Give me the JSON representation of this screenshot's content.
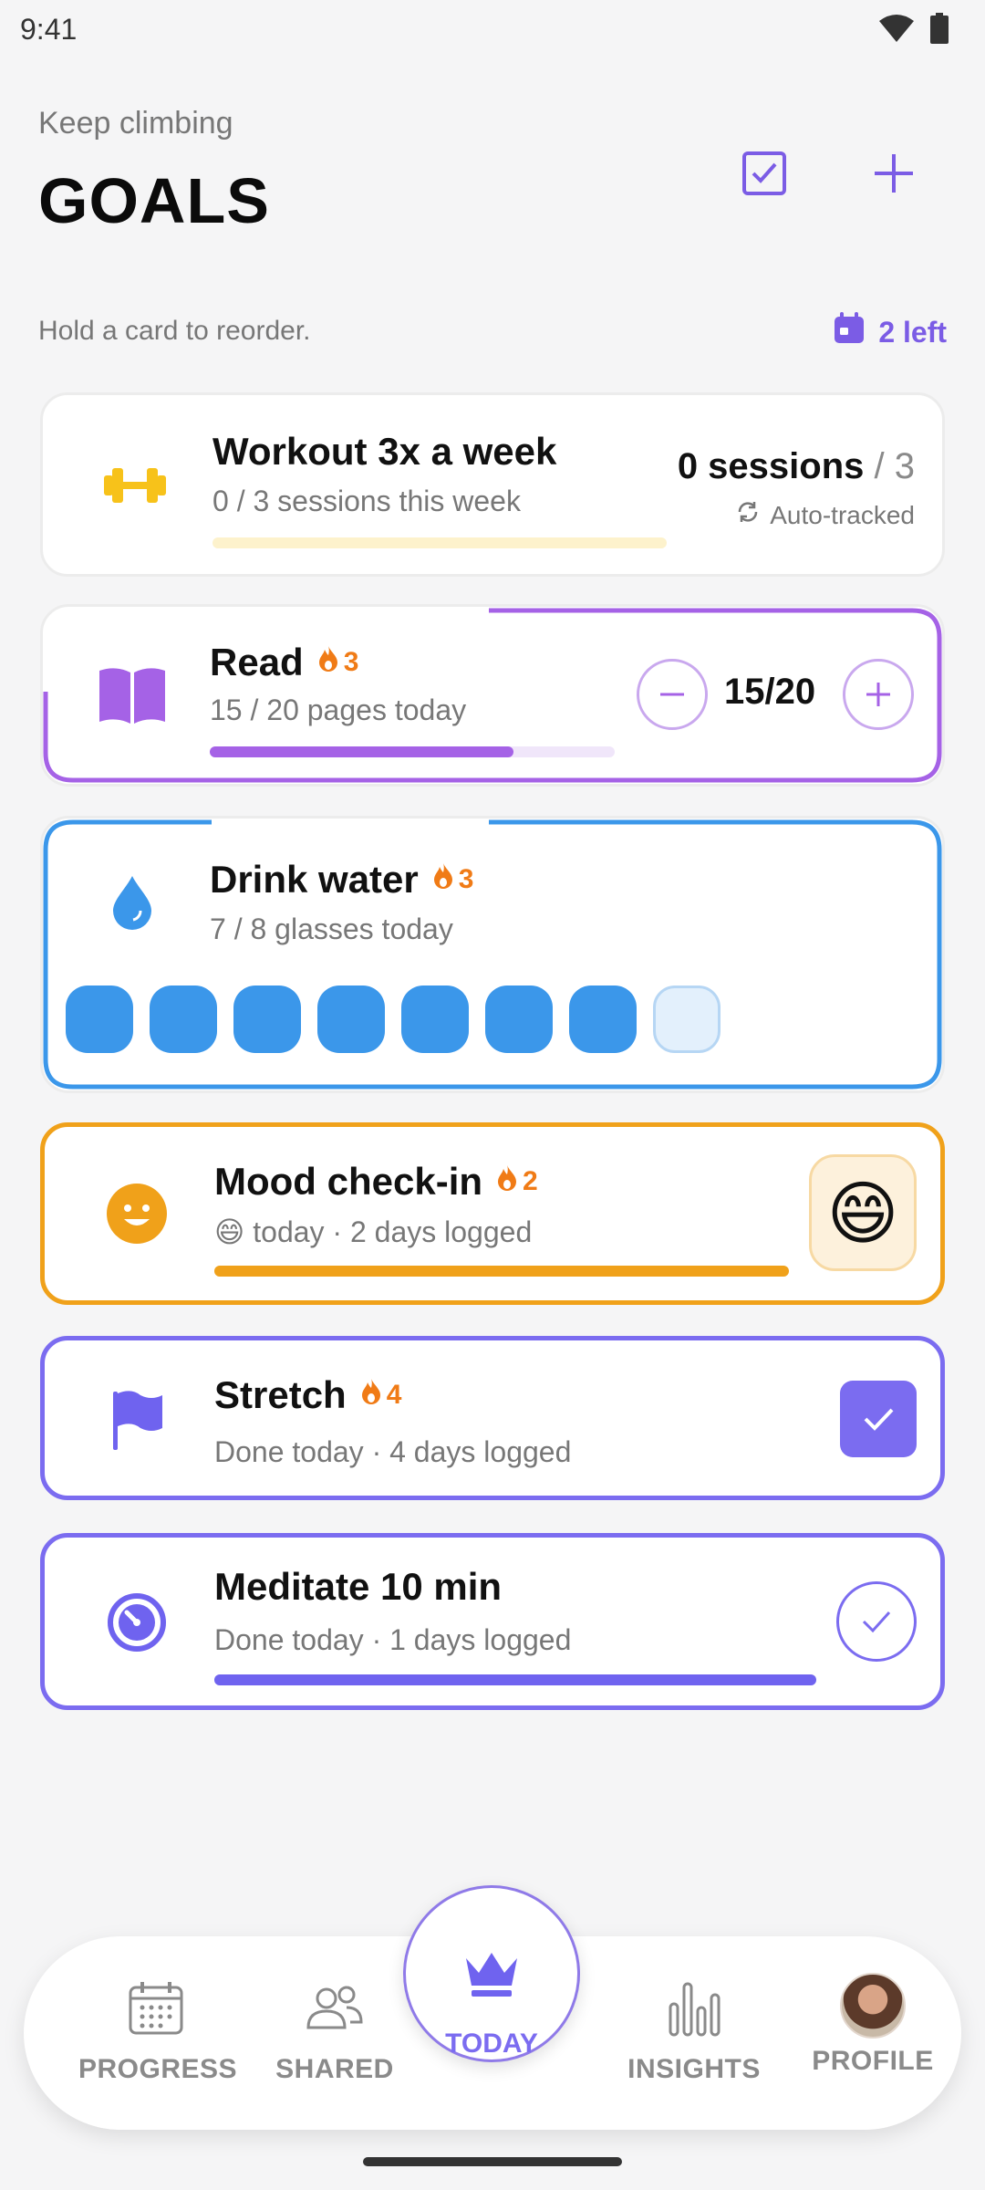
{
  "status_bar": {
    "time": "9:41",
    "icons": [
      "wifi-icon",
      "battery-icon"
    ]
  },
  "header": {
    "subtitle": "Keep climbing",
    "title": "GOALS",
    "actions": [
      "checkbox-icon",
      "plus-icon"
    ]
  },
  "hint": "Hold a card to reorder.",
  "left_badge": {
    "icon": "calendar-icon",
    "text": "2 left"
  },
  "colors": {
    "accent": "#7b5ce5",
    "read": "#a562e6",
    "water": "#3b97ea",
    "mood": "#f0a11a",
    "flame": "#f07b16",
    "workout": "#f7c21a"
  },
  "goals": {
    "workout": {
      "title": "Workout 3x a week",
      "subtitle": "0 / 3 sessions this week",
      "sessions_done": "0 sessions",
      "sessions_total": "/ 3",
      "auto_label": "Auto-tracked",
      "progress": 0,
      "icon": "dumbbell-icon"
    },
    "read": {
      "title": "Read",
      "streak": "3",
      "subtitle": "15 / 20 pages today",
      "counter": "15/20",
      "progress": 0.75,
      "icon": "book-icon"
    },
    "water": {
      "title": "Drink water",
      "streak": "3",
      "subtitle": "7 / 8 glasses today",
      "glasses_filled": 7,
      "glasses_total": 8,
      "icon": "water-drop-icon"
    },
    "mood": {
      "title": "Mood check-in",
      "streak": "2",
      "subtitle": "😄 today · 2 days logged",
      "emoji": "😄",
      "progress": 1,
      "icon": "smiley-icon"
    },
    "stretch": {
      "title": "Stretch",
      "streak": "4",
      "subtitle": "Done today · 4 days logged",
      "done": true,
      "icon": "flag-icon"
    },
    "meditate": {
      "title": "Meditate 10 min",
      "subtitle": "Done today · 1 days logged",
      "done": true,
      "progress": 1,
      "icon": "timer-icon"
    }
  },
  "nav": {
    "items": [
      {
        "label": "PROGRESS",
        "icon": "calendar-grid-icon"
      },
      {
        "label": "SHARED",
        "icon": "people-icon"
      },
      {
        "label": "TODAY",
        "icon": "crown-icon",
        "active": true
      },
      {
        "label": "INSIGHTS",
        "icon": "bar-chart-icon"
      },
      {
        "label": "PROFILE",
        "icon": "avatar"
      }
    ]
  }
}
